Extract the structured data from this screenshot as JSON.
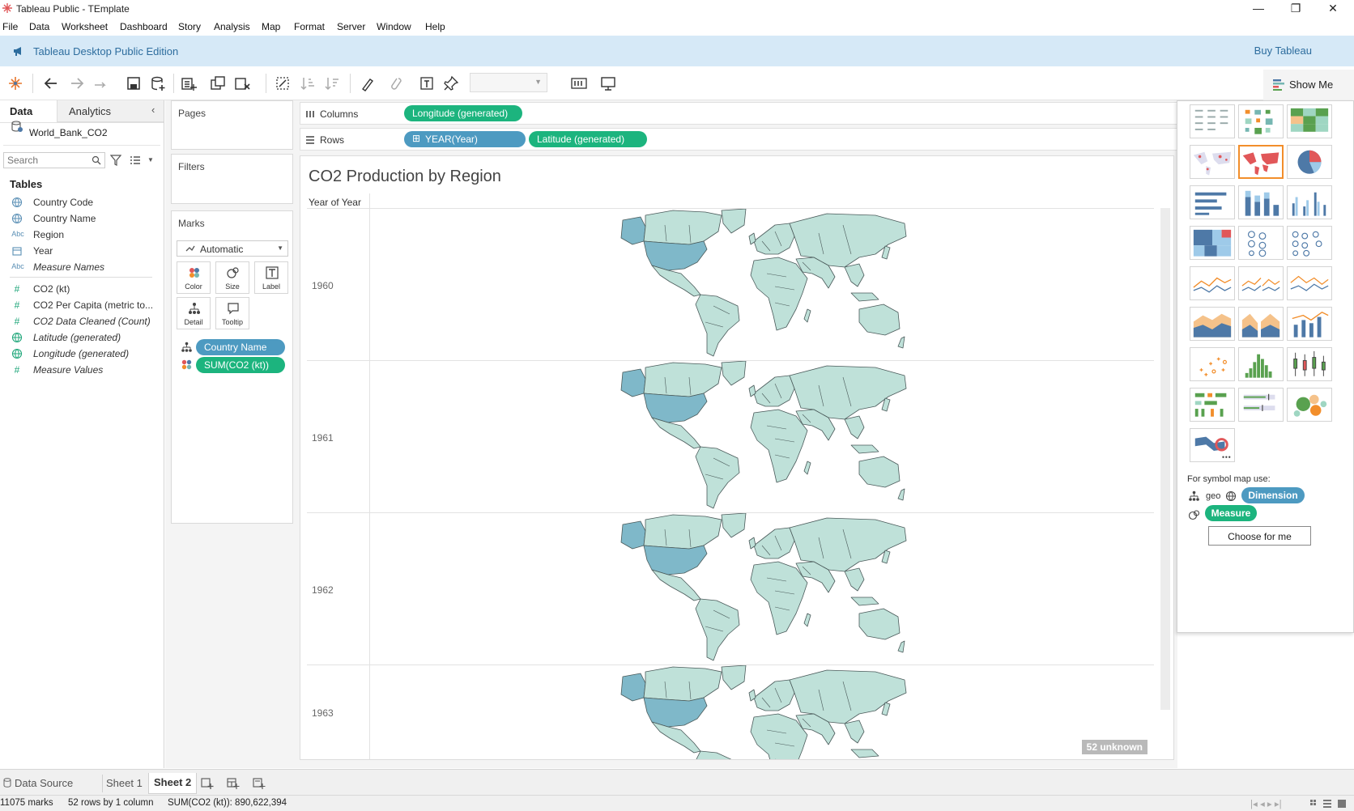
{
  "window": {
    "title": "Tableau Public - TEmplate"
  },
  "menu": [
    "File",
    "Data",
    "Worksheet",
    "Dashboard",
    "Story",
    "Analysis",
    "Map",
    "Format",
    "Server",
    "Window",
    "Help"
  ],
  "banner": {
    "edition": "Tableau Desktop Public Edition",
    "buy": "Buy Tableau"
  },
  "data_pane": {
    "tab_data": "Data",
    "tab_analytics": "Analytics",
    "datasource": "World_Bank_CO2",
    "search_placeholder": "Search",
    "tables_heading": "Tables",
    "fields": [
      {
        "icon": "globe",
        "label": "Country Code",
        "italic": false
      },
      {
        "icon": "globe",
        "label": "Country Name",
        "italic": false
      },
      {
        "icon": "Abc",
        "label": "Region",
        "italic": false
      },
      {
        "icon": "calendar",
        "label": "Year",
        "italic": false
      },
      {
        "icon": "Abc",
        "label": "Measure Names",
        "italic": true
      }
    ],
    "measures": [
      {
        "icon": "#",
        "label": "CO2 (kt)",
        "italic": false
      },
      {
        "icon": "#",
        "label": "CO2 Per Capita (metric to...",
        "italic": false
      },
      {
        "icon": "#",
        "label": "CO2 Data Cleaned (Count)",
        "italic": true
      },
      {
        "icon": "globe",
        "label": "Latitude (generated)",
        "italic": true
      },
      {
        "icon": "globe",
        "label": "Longitude (generated)",
        "italic": true
      },
      {
        "icon": "#",
        "label": "Measure Values",
        "italic": true
      }
    ]
  },
  "cards": {
    "pages": "Pages",
    "filters": "Filters",
    "marks": "Marks",
    "mark_type": "Automatic",
    "buttons": {
      "color": "Color",
      "size": "Size",
      "label": "Label",
      "detail": "Detail",
      "tooltip": "Tooltip"
    },
    "pill_detail": "Country Name",
    "pill_color": "SUM(CO2 (kt))"
  },
  "shelves": {
    "columns_label": "Columns",
    "rows_label": "Rows",
    "columns_pill": "Longitude (generated)",
    "rows_pills": [
      "YEAR(Year)",
      "Latitude (generated)"
    ]
  },
  "view": {
    "title": "CO2 Production by Region",
    "column_header": "Year of Year",
    "years": [
      "1960",
      "1961",
      "1962",
      "1963"
    ],
    "unknown_badge": "52 unknown"
  },
  "show_me": {
    "button": "Show Me",
    "hint": "For symbol map use:",
    "geo_label": "geo",
    "dimension": "Dimension",
    "measure": "Measure",
    "choose": "Choose for me"
  },
  "sheets": {
    "data_source": "Data Source",
    "sheet1": "Sheet 1",
    "sheet2": "Sheet 2"
  },
  "status": {
    "marks": "11075 marks",
    "rows": "52 rows by 1 column",
    "sum": "SUM(CO2 (kt)): 890,622,394"
  },
  "colors": {
    "map_fill": "#bfe1d9",
    "map_highlight": "#7fb8c9",
    "dimension_pill": "#4d9ac1",
    "measure_pill": "#1cb47e",
    "banner": "#d6e9f7"
  }
}
